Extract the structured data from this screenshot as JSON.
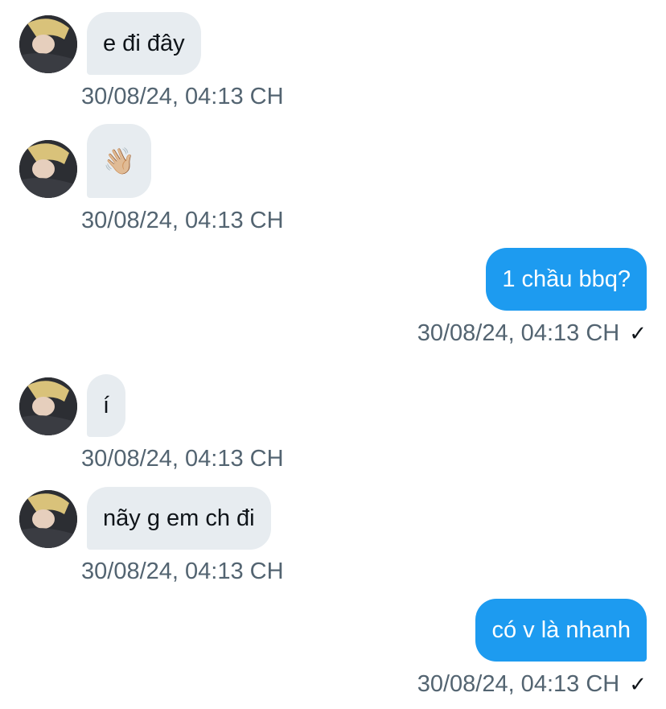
{
  "conversation": {
    "messages": [
      {
        "direction": "in",
        "text": "e đi đây",
        "timestamp": "30/08/24, 04:13 CH"
      },
      {
        "direction": "in",
        "text": "👋🏼",
        "timestamp": "30/08/24, 04:13 CH",
        "is_emoji": true
      },
      {
        "direction": "out",
        "text": "1 chầu bbq?",
        "timestamp": "30/08/24, 04:13 CH",
        "status_icon": "check-icon",
        "status_glyph": "✓"
      },
      {
        "direction": "in",
        "text": "í",
        "timestamp": "30/08/24, 04:13 CH"
      },
      {
        "direction": "in",
        "text": "nãy g em ch đi",
        "timestamp": "30/08/24, 04:13 CH"
      },
      {
        "direction": "out",
        "text": "có v là nhanh",
        "timestamp": "30/08/24, 04:13 CH",
        "status_icon": "check-icon",
        "status_glyph": "✓"
      }
    ]
  },
  "colors": {
    "incoming_bubble": "#e7ecf0",
    "outgoing_bubble": "#1d9bf0",
    "timestamp_text": "#536471",
    "message_text": "#0f1419"
  }
}
